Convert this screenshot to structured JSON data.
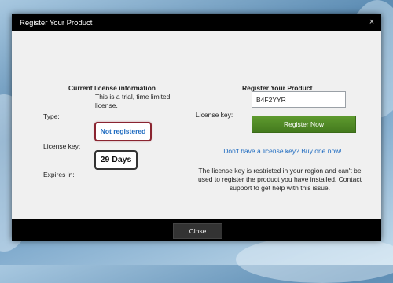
{
  "window": {
    "title": "Register Your Product",
    "close_glyph": "×"
  },
  "current_license": {
    "heading": "Current license information",
    "type_label": "Type:",
    "type_value": "This is a trial, time limited license.",
    "license_key_label": "License key:",
    "license_key_status": "Not registered",
    "expires_label": "Expires in:",
    "expires_value": "29 Days"
  },
  "register": {
    "heading": "Register Your Product",
    "license_key_label": "License key:",
    "license_key_value": "B4F2YYR",
    "register_button": "Register Now",
    "buy_link": "Don't have a license key? Buy one now!",
    "notice": "The license key is restricted in your region and can't be used to register the product you have installed. Contact support to get help with this issue."
  },
  "footer": {
    "close_button": "Close"
  },
  "colors": {
    "accent_link": "#1e6bc0",
    "register_button": "#4f8a26",
    "badge_border": "#8a2430"
  }
}
